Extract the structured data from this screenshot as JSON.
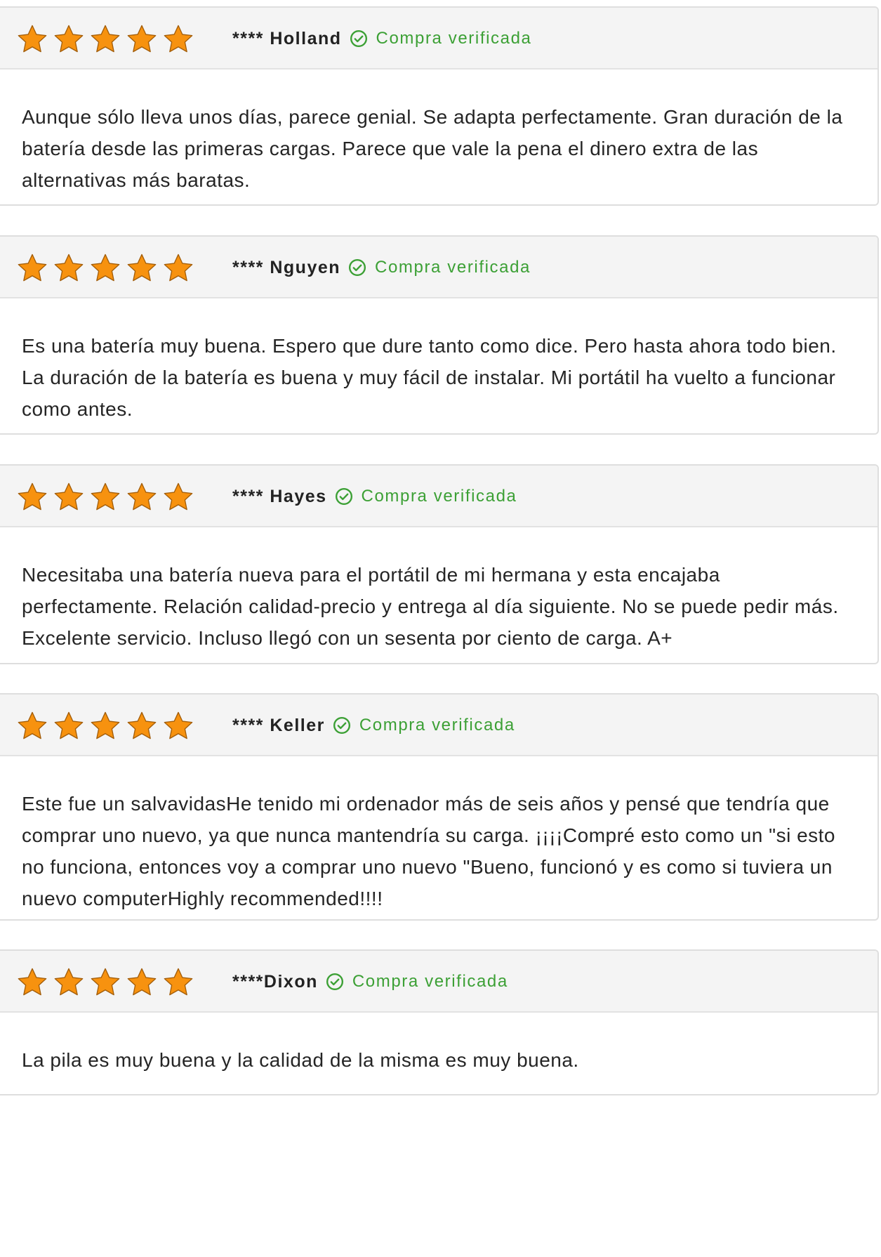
{
  "reviews": [
    {
      "reviewer": "**** Holland",
      "rating": 5,
      "badge": "Compra verificada",
      "text": "Aunque sólo lleva unos días, parece genial. Se adapta perfectamente. Gran duración de la batería desde las primeras cargas. Parece que vale la pena el dinero extra de las alternativas más baratas."
    },
    {
      "reviewer": "**** Nguyen",
      "rating": 5,
      "badge": "Compra verificada",
      "text": "Es una batería muy buena. Espero que dure tanto como dice. Pero hasta ahora todo bien. La duración de la batería es buena y muy fácil de instalar. Mi portátil ha vuelto a funcionar como antes."
    },
    {
      "reviewer": "**** Hayes",
      "rating": 5,
      "badge": "Compra verificada",
      "text": "Necesitaba una batería nueva para el portátil de mi hermana y esta encajaba perfectamente. Relación calidad-precio y entrega al día siguiente. No se puede pedir más. Excelente servicio. Incluso llegó con un sesenta por ciento de carga. A+"
    },
    {
      "reviewer": "**** Keller",
      "rating": 5,
      "badge": "Compra verificada",
      "text": "Este fue un salvavidasHe tenido mi ordenador más de seis años y pensé que tendría que comprar uno nuevo, ya que nunca mantendría su carga. ¡¡¡¡Compré esto como un \"si esto no funciona, entonces voy a comprar uno nuevo \"Bueno, funcionó y es como si tuviera un nuevo computerHighly recommended!!!!"
    },
    {
      "reviewer": "****Dixon",
      "rating": 5,
      "badge": "Compra verificada",
      "text": "La pila es muy buena y la calidad de la misma es muy buena."
    }
  ],
  "colors": {
    "star_fill": "#f7920f",
    "star_stroke": "#a25d0a",
    "verified_green": "#3ca035",
    "header_bg": "#f4f4f4",
    "border": "#dedede"
  },
  "icons": {
    "rating": "star-icon",
    "verified": "check-circle-icon"
  }
}
